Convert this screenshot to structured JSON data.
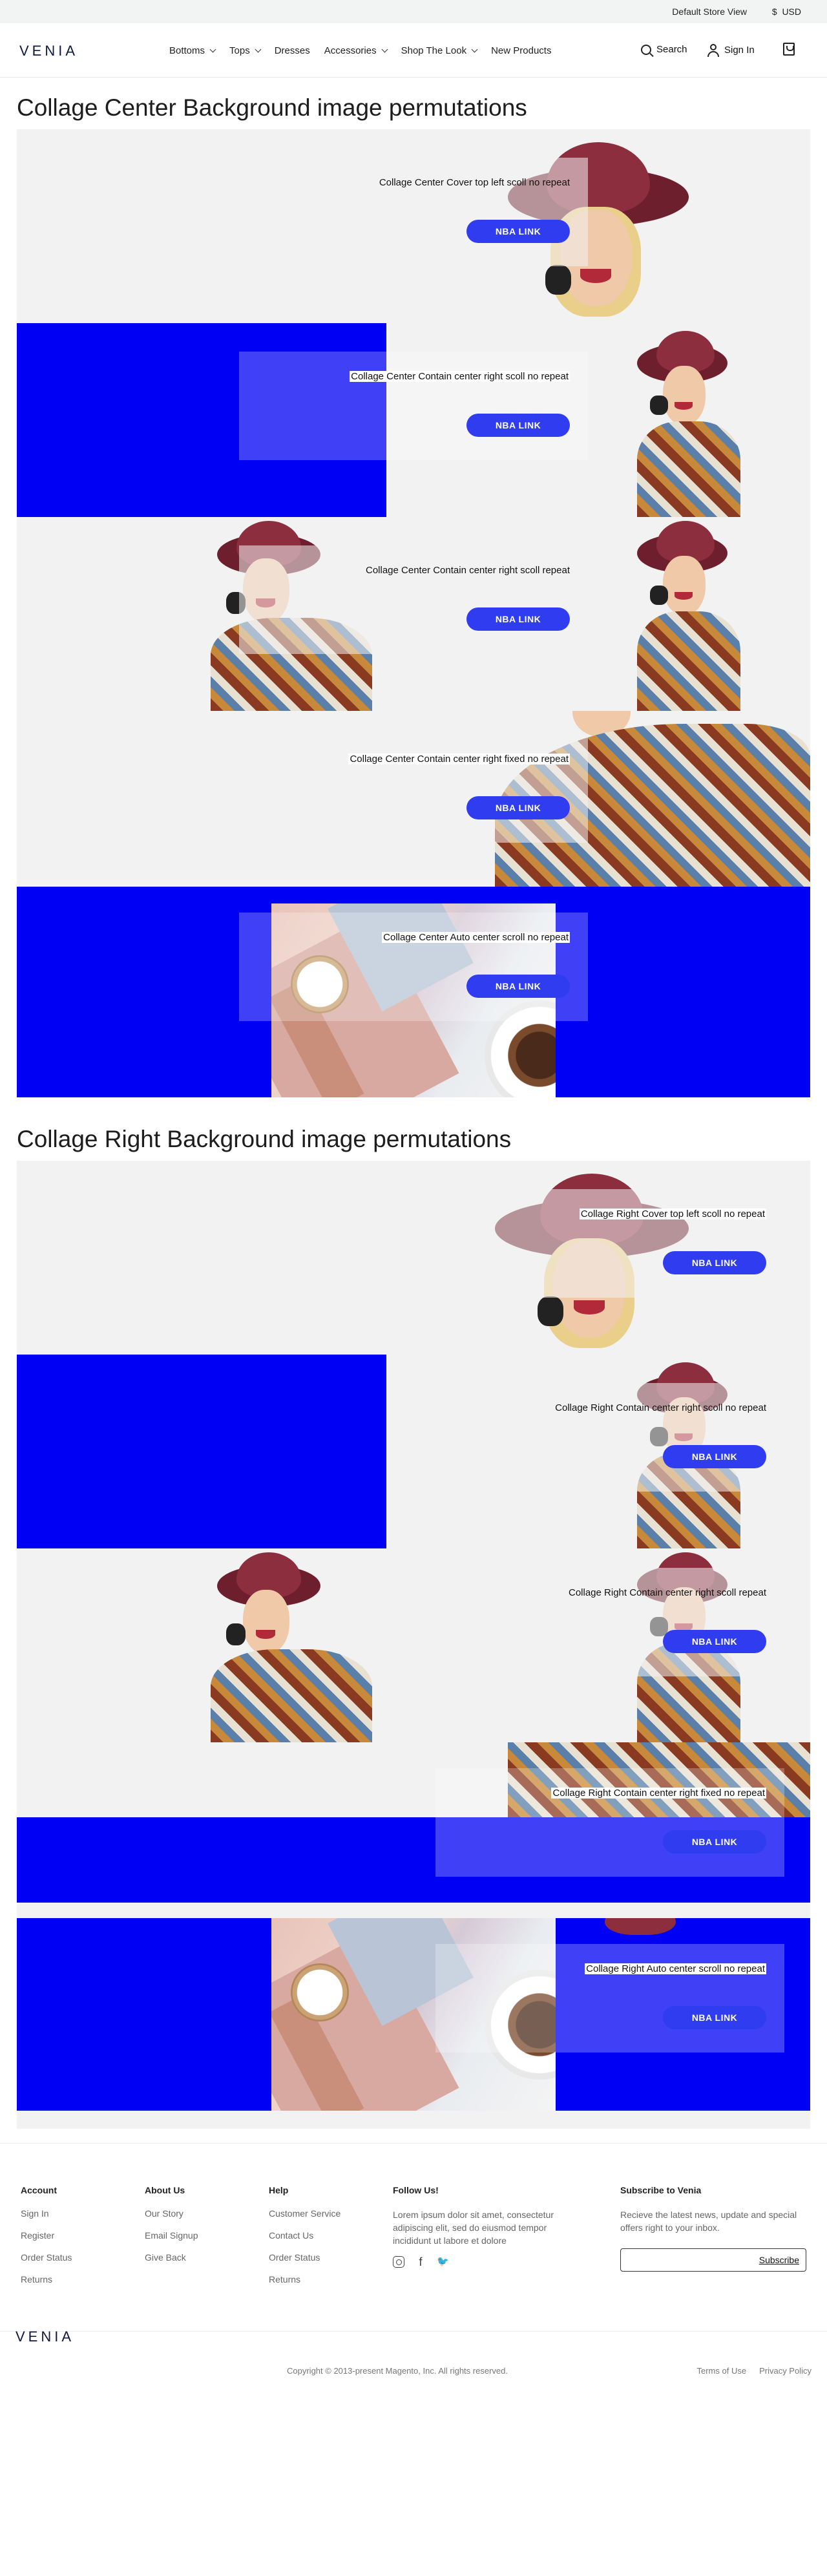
{
  "topbar": {
    "store_view": "Default Store View",
    "currency_symbol": "$",
    "currency": "USD"
  },
  "header": {
    "logo": "VENIA",
    "nav": [
      {
        "label": "Bottoms",
        "has_dropdown": true
      },
      {
        "label": "Tops",
        "has_dropdown": true
      },
      {
        "label": "Dresses",
        "has_dropdown": false
      },
      {
        "label": "Accessories",
        "has_dropdown": true
      },
      {
        "label": "Shop The Look",
        "has_dropdown": true
      },
      {
        "label": "New Products",
        "has_dropdown": false
      }
    ],
    "search_label": "Search",
    "signin_label": "Sign In"
  },
  "colors": {
    "accent_blue": "#0000f5",
    "cta_blue": "#2f3cf0",
    "panel_gray": "#f2f2f2"
  },
  "sections": [
    {
      "title": "Collage Center Background image permutations",
      "panels": [
        {
          "text": "Collage Center Cover top left scoll no repeat",
          "cta": "NBA LINK"
        },
        {
          "text": "Collage Center Contain center right scoll no repeat",
          "cta": "NBA LINK"
        },
        {
          "text": "Collage Center Contain center right scoll repeat",
          "cta": "NBA LINK"
        },
        {
          "text": "Collage Center Contain center right fixed no repeat",
          "cta": "NBA LINK"
        },
        {
          "text": "Collage Center Auto center  scroll no repeat",
          "cta": "NBA LINK"
        }
      ]
    },
    {
      "title": "Collage Right Background image permutations",
      "panels": [
        {
          "text": "Collage Right Cover top left scoll no repeat",
          "cta": "NBA LINK"
        },
        {
          "text": "Collage Right Contain center right scoll no repeat",
          "cta": "NBA LINK"
        },
        {
          "text": "Collage Right Contain center right scoll repeat",
          "cta": "NBA LINK"
        },
        {
          "text": "Collage Right Contain center right fixed no repeat",
          "cta": "NBA LINK"
        },
        {
          "text": "Collage Right Auto center  scroll no repeat",
          "cta": "NBA LINK"
        }
      ]
    }
  ],
  "footer": {
    "columns": [
      {
        "title": "Account",
        "links": [
          "Sign In",
          "Register",
          "Order Status",
          "Returns"
        ]
      },
      {
        "title": "About Us",
        "links": [
          "Our Story",
          "Email Signup",
          "Give Back"
        ]
      },
      {
        "title": "Help",
        "links": [
          "Customer Service",
          "Contact Us",
          "Order Status",
          "Returns"
        ]
      }
    ],
    "follow": {
      "title": "Follow Us!",
      "text": "Lorem ipsum dolor sit amet, consectetur adipiscing elit, sed do eiusmod tempor incididunt ut labore et dolore",
      "icons": [
        "instagram-icon",
        "facebook-icon",
        "twitter-icon"
      ]
    },
    "subscribe": {
      "title": "Subscribe to Venia",
      "text": "Recieve the latest news, update and special offers right to your inbox.",
      "button": "Subscribe"
    },
    "logo": "VENIA",
    "copyright": "Copyright © 2013-present Magento, Inc. All rights reserved.",
    "legal_links": [
      "Terms of Use",
      "Privacy Policy"
    ]
  }
}
